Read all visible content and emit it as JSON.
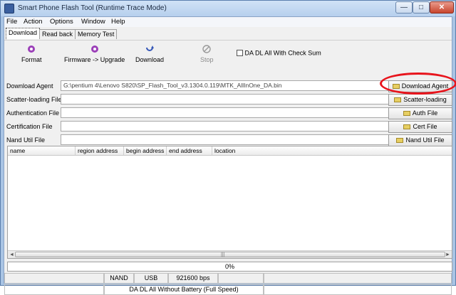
{
  "window": {
    "title": "Smart Phone Flash Tool (Runtime Trace Mode)",
    "minimize": "—",
    "maximize": "□",
    "close": "✕"
  },
  "menu": [
    "File",
    "Action",
    "Options",
    "Window",
    "Help"
  ],
  "tabs": [
    "Download",
    "Read back",
    "Memory Test"
  ],
  "toolbar": {
    "format": "Format",
    "firmware_upgrade": "Firmware -> Upgrade",
    "download": "Download",
    "stop": "Stop",
    "checksum_label": "DA DL All With Check Sum",
    "checksum_checked": false
  },
  "files": [
    {
      "label": "Download Agent",
      "path": "G:\\pentium 4\\Lenovo S820\\SP_Flash_Tool_v3.1304.0.119\\MTK_AllInOne_DA.bin",
      "button": "Download Agent"
    },
    {
      "label": "Scatter-loading File",
      "path": "",
      "button": "Scatter-loading"
    },
    {
      "label": "Authentication File",
      "path": "",
      "button": "Auth File"
    },
    {
      "label": "Certification File",
      "path": "",
      "button": "Cert File"
    },
    {
      "label": "Nand Util File",
      "path": "",
      "button": "Nand Util File"
    }
  ],
  "table": {
    "columns": [
      "name",
      "region address",
      "begin address",
      "end address",
      "location"
    ]
  },
  "scrollbar": {
    "left_arrow": "◄",
    "right_arrow": "►",
    "grip": "|||"
  },
  "progress": {
    "value": 0,
    "text": "0%"
  },
  "status": {
    "storage": "NAND",
    "port": "USB",
    "baud": "921600 bps"
  },
  "status_mode": "DA DL All Without Battery (Full Speed)",
  "colors": {
    "highlight": "#e8141c",
    "titlebar": "#b6cfed",
    "progress": "#3a8dde"
  },
  "icons": {
    "format": "format-icon",
    "firmware": "firmware-upgrade-icon",
    "download": "download-icon",
    "stop": "stop-icon",
    "folder": "folder-icon"
  }
}
